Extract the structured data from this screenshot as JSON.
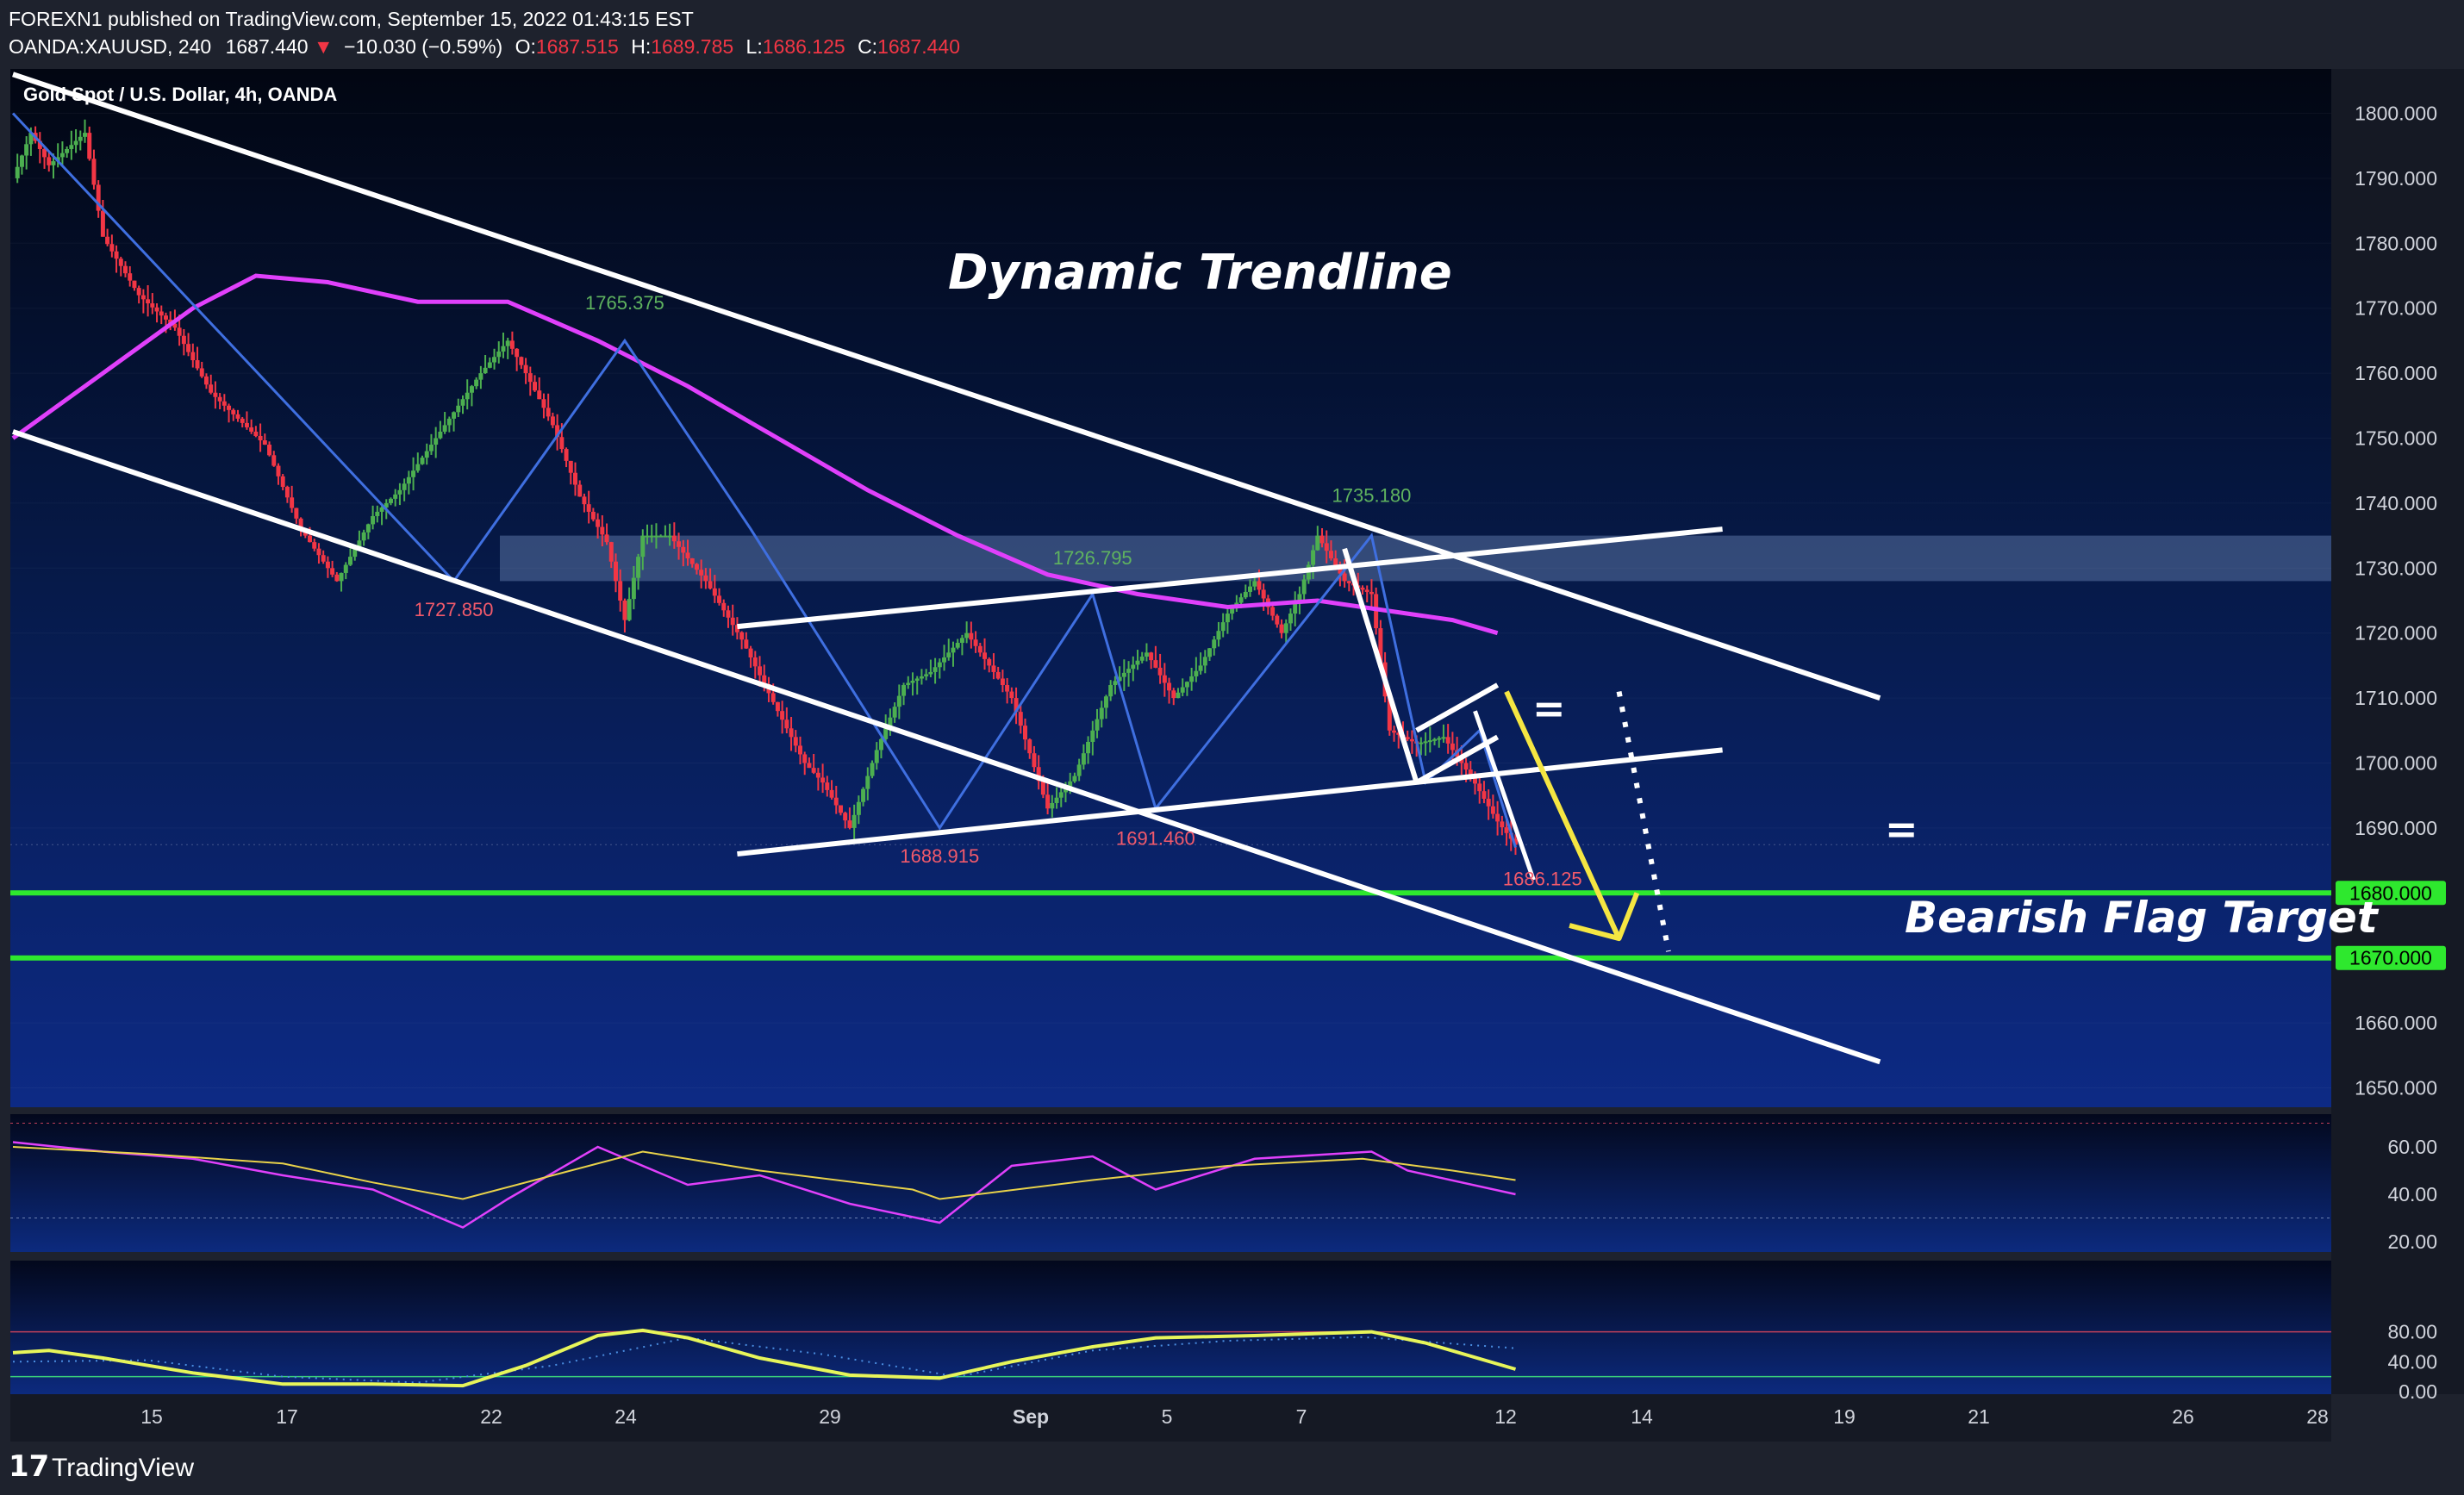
{
  "header": {
    "line1": "FOREXN1 published on TradingView.com, September 15, 2022 01:43:15 EST",
    "symbol": "OANDA:XAUUSD, 240",
    "last": "1687.440",
    "change": "−10.030 (−0.59%)",
    "o_label": "O:",
    "o_val": "1687.515",
    "h_label": "H:",
    "h_val": "1689.785",
    "l_label": "L:",
    "l_val": "1686.125",
    "c_label": "C:",
    "c_val": "1687.440"
  },
  "chart_title": "Gold Spot / U.S. Dollar, 4h, OANDA",
  "annotations": {
    "dynamic_trendline": "Dynamic Trendline",
    "bearish_flag_target": "Bearish Flag Target",
    "equal_sign": "="
  },
  "footer": {
    "brand": "TradingView"
  },
  "colors": {
    "up": "#4caf50",
    "down": "#f23645",
    "ma": "#e040fb",
    "trendline": "#ffffff",
    "zigzag": "#3f6fe0",
    "target": "#2ee82e",
    "arrow": "#f5e642",
    "label_red": "#f25a6b",
    "label_green": "#5fb35f"
  },
  "chart_data": [
    {
      "type": "candlestick",
      "title": "Gold Spot / U.S. Dollar, 4h, OANDA",
      "ylim": [
        1645,
        1805
      ],
      "yticks": [
        "1650.000",
        "1660.000",
        "1670.000",
        "1680.000",
        "1690.000",
        "1700.000",
        "1710.000",
        "1720.000",
        "1730.000",
        "1740.000",
        "1750.000",
        "1760.000",
        "1770.000",
        "1780.000",
        "1790.000",
        "1800.000"
      ],
      "xticks": [
        "15",
        "17",
        "22",
        "24",
        "29",
        "Sep",
        "5",
        "7",
        "12",
        "14",
        "19",
        "21",
        "26",
        "28"
      ],
      "price_labels": [
        "1680.000",
        "1670.000"
      ],
      "waypoints": [
        [
          0,
          1790
        ],
        [
          4,
          1797
        ],
        [
          8,
          1792
        ],
        [
          16,
          1797
        ],
        [
          20,
          1781
        ],
        [
          28,
          1772
        ],
        [
          36,
          1767
        ],
        [
          44,
          1757
        ],
        [
          56,
          1749
        ],
        [
          64,
          1736
        ],
        [
          72,
          1728
        ],
        [
          80,
          1738
        ],
        [
          86,
          1742
        ],
        [
          94,
          1750
        ],
        [
          104,
          1760
        ],
        [
          110,
          1765
        ],
        [
          114,
          1760
        ],
        [
          120,
          1752
        ],
        [
          126,
          1741
        ],
        [
          132,
          1734
        ],
        [
          136,
          1722
        ],
        [
          140,
          1735
        ],
        [
          146,
          1735
        ],
        [
          154,
          1728
        ],
        [
          162,
          1719
        ],
        [
          170,
          1708
        ],
        [
          176,
          1700
        ],
        [
          180,
          1697
        ],
        [
          186,
          1690
        ],
        [
          192,
          1702
        ],
        [
          198,
          1712
        ],
        [
          204,
          1714
        ],
        [
          212,
          1720
        ],
        [
          222,
          1710
        ],
        [
          230,
          1693
        ],
        [
          236,
          1698
        ],
        [
          244,
          1712
        ],
        [
          252,
          1717
        ],
        [
          258,
          1710
        ],
        [
          264,
          1715
        ],
        [
          270,
          1723
        ],
        [
          276,
          1728
        ],
        [
          282,
          1720
        ],
        [
          286,
          1726
        ],
        [
          290,
          1735
        ],
        [
          296,
          1728
        ],
        [
          302,
          1726
        ],
        [
          306,
          1705
        ],
        [
          312,
          1703
        ],
        [
          318,
          1704
        ],
        [
          324,
          1698
        ],
        [
          330,
          1691
        ],
        [
          334,
          1687.44
        ]
      ],
      "moving_average": [
        [
          0,
          1750
        ],
        [
          20,
          1760
        ],
        [
          40,
          1770
        ],
        [
          54,
          1775
        ],
        [
          70,
          1774
        ],
        [
          90,
          1771
        ],
        [
          110,
          1771
        ],
        [
          130,
          1765
        ],
        [
          150,
          1758
        ],
        [
          170,
          1750
        ],
        [
          190,
          1742
        ],
        [
          210,
          1735
        ],
        [
          230,
          1729
        ],
        [
          250,
          1726
        ],
        [
          270,
          1724
        ],
        [
          290,
          1725
        ],
        [
          310,
          1723
        ],
        [
          320,
          1722
        ],
        [
          330,
          1720
        ]
      ],
      "levels": [
        {
          "name": "resistance-zone",
          "low": 1728,
          "high": 1735
        },
        {
          "name": "target-1",
          "value": 1680
        },
        {
          "name": "target-2",
          "value": 1670
        }
      ],
      "trendlines": [
        {
          "name": "channel-upper",
          "points": [
            [
              0,
              1806
            ],
            [
              415,
              1710
            ]
          ]
        },
        {
          "name": "channel-lower",
          "points": [
            [
              0,
              1751
            ],
            [
              415,
              1654
            ]
          ]
        },
        {
          "name": "flag-upper",
          "points": [
            [
              161,
              1721
            ],
            [
              380,
              1736
            ]
          ]
        },
        {
          "name": "flag-lower",
          "points": [
            [
              161,
              1686
            ],
            [
              380,
              1702
            ]
          ]
        }
      ],
      "zigzag": [
        [
          0,
          1800
        ],
        [
          98,
          1728
        ],
        [
          136,
          1765
        ],
        [
          164,
          1736
        ],
        [
          206,
          1690
        ],
        [
          240,
          1726
        ],
        [
          254,
          1693
        ],
        [
          302,
          1735
        ],
        [
          314,
          1697
        ],
        [
          326,
          1705
        ],
        [
          334,
          1687
        ]
      ],
      "point_labels": [
        {
          "text": "1727.850",
          "index": 98,
          "value": 1722.6,
          "color": "red"
        },
        {
          "text": "1765.375",
          "index": 136,
          "value": 1769.8,
          "color": "green"
        },
        {
          "text": "1726.795",
          "index": 240,
          "value": 1730.6,
          "color": "green"
        },
        {
          "text": "1688.915",
          "index": 206,
          "value": 1684.7,
          "color": "red"
        },
        {
          "text": "1691.460",
          "index": 254,
          "value": 1687.4,
          "color": "red"
        },
        {
          "text": "1735.180",
          "index": 302,
          "value": 1740.2,
          "color": "green"
        },
        {
          "text": "1686.125",
          "index": 340,
          "value": 1681.2,
          "color": "red"
        }
      ]
    },
    {
      "type": "line",
      "name": "RSI",
      "ylim": [
        15,
        72
      ],
      "yticks": [
        "20.00",
        "40.00",
        "60.00"
      ],
      "bands": [
        30,
        70
      ],
      "series": [
        {
          "values": [
            [
              0,
              62
            ],
            [
              20,
              58
            ],
            [
              40,
              55
            ],
            [
              60,
              48
            ],
            [
              80,
              42
            ],
            [
              100,
              26
            ],
            [
              110,
              38
            ],
            [
              130,
              60
            ],
            [
              150,
              44
            ],
            [
              166,
              48
            ],
            [
              186,
              36
            ],
            [
              206,
              28
            ],
            [
              222,
              52
            ],
            [
              240,
              56
            ],
            [
              254,
              42
            ],
            [
              276,
              55
            ],
            [
              302,
              58
            ],
            [
              310,
              50
            ],
            [
              334,
              40
            ]
          ]
        },
        {
          "values": [
            [
              0,
              60
            ],
            [
              30,
              57
            ],
            [
              60,
              53
            ],
            [
              80,
              45
            ],
            [
              100,
              38
            ],
            [
              120,
              48
            ],
            [
              140,
              58
            ],
            [
              166,
              50
            ],
            [
              200,
              42
            ],
            [
              206,
              38
            ],
            [
              240,
              46
            ],
            [
              270,
              52
            ],
            [
              300,
              55
            ],
            [
              320,
              50
            ],
            [
              334,
              46
            ]
          ]
        }
      ]
    },
    {
      "type": "line",
      "name": "Stochastic",
      "ylim": [
        0,
        85
      ],
      "yticks": [
        "0.00",
        "40.00",
        "80.00"
      ],
      "bands": [
        20,
        80
      ],
      "series": [
        {
          "values": [
            [
              0,
              52
            ],
            [
              8,
              55
            ],
            [
              20,
              45
            ],
            [
              40,
              25
            ],
            [
              60,
              10
            ],
            [
              80,
              10
            ],
            [
              100,
              8
            ],
            [
              114,
              35
            ],
            [
              130,
              75
            ],
            [
              140,
              82
            ],
            [
              150,
              72
            ],
            [
              166,
              45
            ],
            [
              186,
              22
            ],
            [
              206,
              18
            ],
            [
              222,
              40
            ],
            [
              240,
              60
            ],
            [
              254,
              72
            ],
            [
              276,
              75
            ],
            [
              302,
              80
            ],
            [
              314,
              65
            ],
            [
              334,
              30
            ]
          ]
        },
        {
          "values": [
            [
              0,
              40
            ],
            [
              30,
              42
            ],
            [
              60,
              20
            ],
            [
              90,
              12
            ],
            [
              120,
              35
            ],
            [
              150,
              72
            ],
            [
              180,
              50
            ],
            [
              210,
              20
            ],
            [
              240,
              55
            ],
            [
              270,
              68
            ],
            [
              300,
              73
            ],
            [
              334,
              58
            ]
          ]
        }
      ]
    }
  ]
}
